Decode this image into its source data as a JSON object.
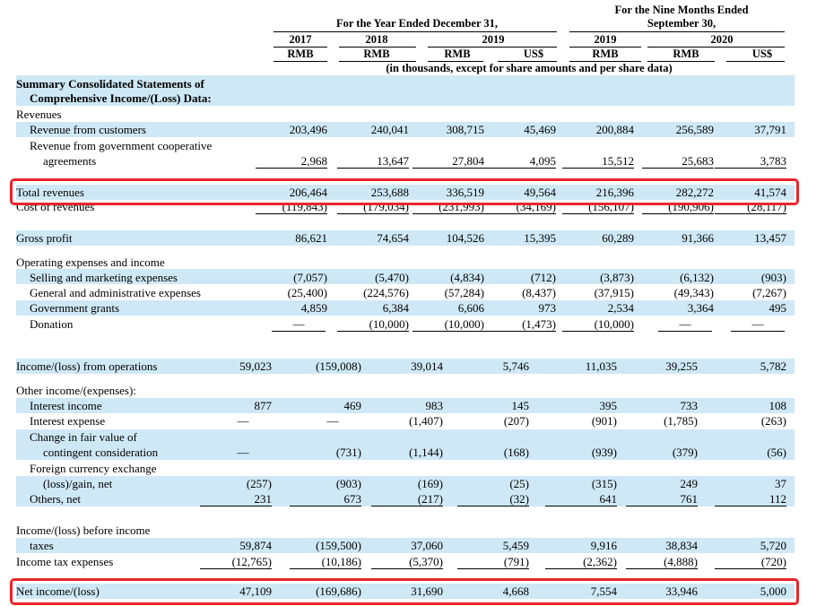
{
  "header": {
    "year_group": "For the Year Ended December 31,",
    "nine_group_l1": "For the Nine Months Ended",
    "nine_group_l2": "September 30,",
    "y2019_group": "2019",
    "n2020_group": "2020",
    "years": [
      "2017",
      "2018",
      "2019",
      "2019"
    ],
    "currencies": [
      "RMB",
      "RMB",
      "RMB",
      "US$",
      "RMB",
      "RMB",
      "US$"
    ],
    "units_note": "(in thousands, except for share amounts and per share data)"
  },
  "section_title_l1": "Summary Consolidated Statements of",
  "section_title_l2": "Comprehensive Income/(Loss) Data:",
  "rows": {
    "revenues": "Revenues",
    "rev_customers": {
      "label": "Revenue from customers",
      "v": [
        "203,496",
        "240,041",
        "308,715",
        "45,469",
        "200,884",
        "256,589",
        "37,791"
      ]
    },
    "rev_gov_l1": "Revenue from government cooperative",
    "rev_gov": {
      "label": "agreements",
      "v": [
        "2,968",
        "13,647",
        "27,804",
        "4,095",
        "15,512",
        "25,683",
        "3,783"
      ]
    },
    "total_revenues": {
      "label": "Total revenues",
      "v": [
        "206,464",
        "253,688",
        "336,519",
        "49,564",
        "216,396",
        "282,272",
        "41,574"
      ]
    },
    "cost_revenues": {
      "label": "Cost of revenues",
      "v": [
        "(119,843)",
        "(179,034)",
        "(231,993)",
        "(34,169)",
        "(156,107)",
        "(190,906)",
        "(28,117)"
      ]
    },
    "gross_profit": {
      "label": "Gross profit",
      "v": [
        "86,621",
        "74,654",
        "104,526",
        "15,395",
        "60,289",
        "91,366",
        "13,457"
      ]
    },
    "opex_title": "Operating expenses and income",
    "selling": {
      "label": "Selling and marketing expenses",
      "v": [
        "(7,057)",
        "(5,470)",
        "(4,834)",
        "(712)",
        "(3,873)",
        "(6,132)",
        "(903)"
      ]
    },
    "gna": {
      "label": "General and administrative expenses",
      "v": [
        "(25,400)",
        "(224,576)",
        "(57,284)",
        "(8,437)",
        "(37,915)",
        "(49,343)",
        "(7,267)"
      ]
    },
    "grants": {
      "label": "Government grants",
      "v": [
        "4,859",
        "6,384",
        "6,606",
        "973",
        "2,534",
        "3,364",
        "495"
      ]
    },
    "donation": {
      "label": "Donation",
      "v": [
        "—",
        "(10,000)",
        "(10,000)",
        "(1,473)",
        "(10,000)",
        "—",
        "—"
      ]
    },
    "income_ops": {
      "label": "Income/(loss) from operations",
      "v": [
        "59,023",
        "(159,008)",
        "39,014",
        "5,746",
        "11,035",
        "39,255",
        "5,782"
      ]
    },
    "other_title": "Other income/(expenses):",
    "interest_income": {
      "label": "Interest income",
      "v": [
        "877",
        "469",
        "983",
        "145",
        "395",
        "733",
        "108"
      ]
    },
    "interest_expense": {
      "label": "Interest expense",
      "v": [
        "—",
        "—",
        "(1,407)",
        "(207)",
        "(901)",
        "(1,785)",
        "(263)"
      ]
    },
    "fair_value_l1": "Change in fair value of",
    "fair_value": {
      "label": "contingent consideration",
      "v": [
        "—",
        "(731)",
        "(1,144)",
        "(168)",
        "(939)",
        "(379)",
        "(56)"
      ]
    },
    "fx_l1": "Foreign currency exchange",
    "fx": {
      "label": "(loss)/gain, net",
      "v": [
        "(257)",
        "(903)",
        "(169)",
        "(25)",
        "(315)",
        "249",
        "37"
      ]
    },
    "others": {
      "label": "Others, net",
      "v": [
        "231",
        "673",
        "(217)",
        "(32)",
        "641",
        "761",
        "112"
      ]
    },
    "pretax_l1": "Income/(loss) before income",
    "pretax": {
      "label": "taxes",
      "v": [
        "59,874",
        "(159,500)",
        "37,060",
        "5,459",
        "9,916",
        "38,834",
        "5,720"
      ]
    },
    "tax": {
      "label": "Income tax expenses",
      "v": [
        "(12,765)",
        "(10,186)",
        "(5,370)",
        "(791)",
        "(2,362)",
        "(4,888)",
        "(720)"
      ]
    },
    "net_income": {
      "label": "Net income/(loss)",
      "v": [
        "47,109",
        "(169,686)",
        "31,690",
        "4,668",
        "7,554",
        "33,946",
        "5,000"
      ]
    }
  },
  "colors": {
    "band": "#cfe8f6",
    "highlight": "#e8262a"
  }
}
